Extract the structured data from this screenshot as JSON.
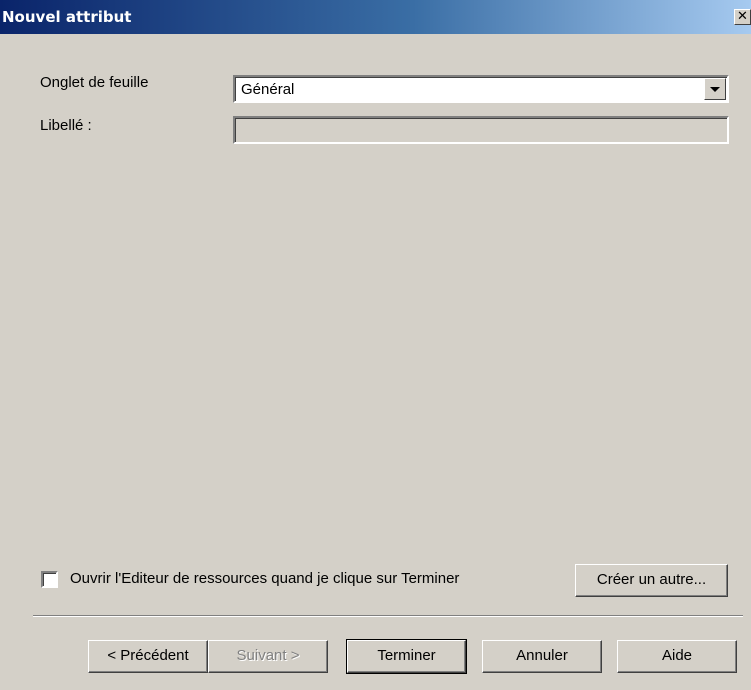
{
  "window": {
    "title": "Nouvel attribut",
    "close_glyph": "✕"
  },
  "form": {
    "sheet_tab_label": "Onglet de feuille",
    "sheet_tab_value": "Général",
    "caption_label": "Libellé :",
    "caption_value": ""
  },
  "options": {
    "open_editor_label": "Ouvrir l'Editeur de ressources quand je clique sur Terminer",
    "open_editor_checked": false,
    "create_another_label": "Créer un autre..."
  },
  "buttons": {
    "previous": "< Précédent",
    "next": "Suivant >",
    "finish": "Terminer",
    "cancel": "Annuler",
    "help": "Aide"
  }
}
